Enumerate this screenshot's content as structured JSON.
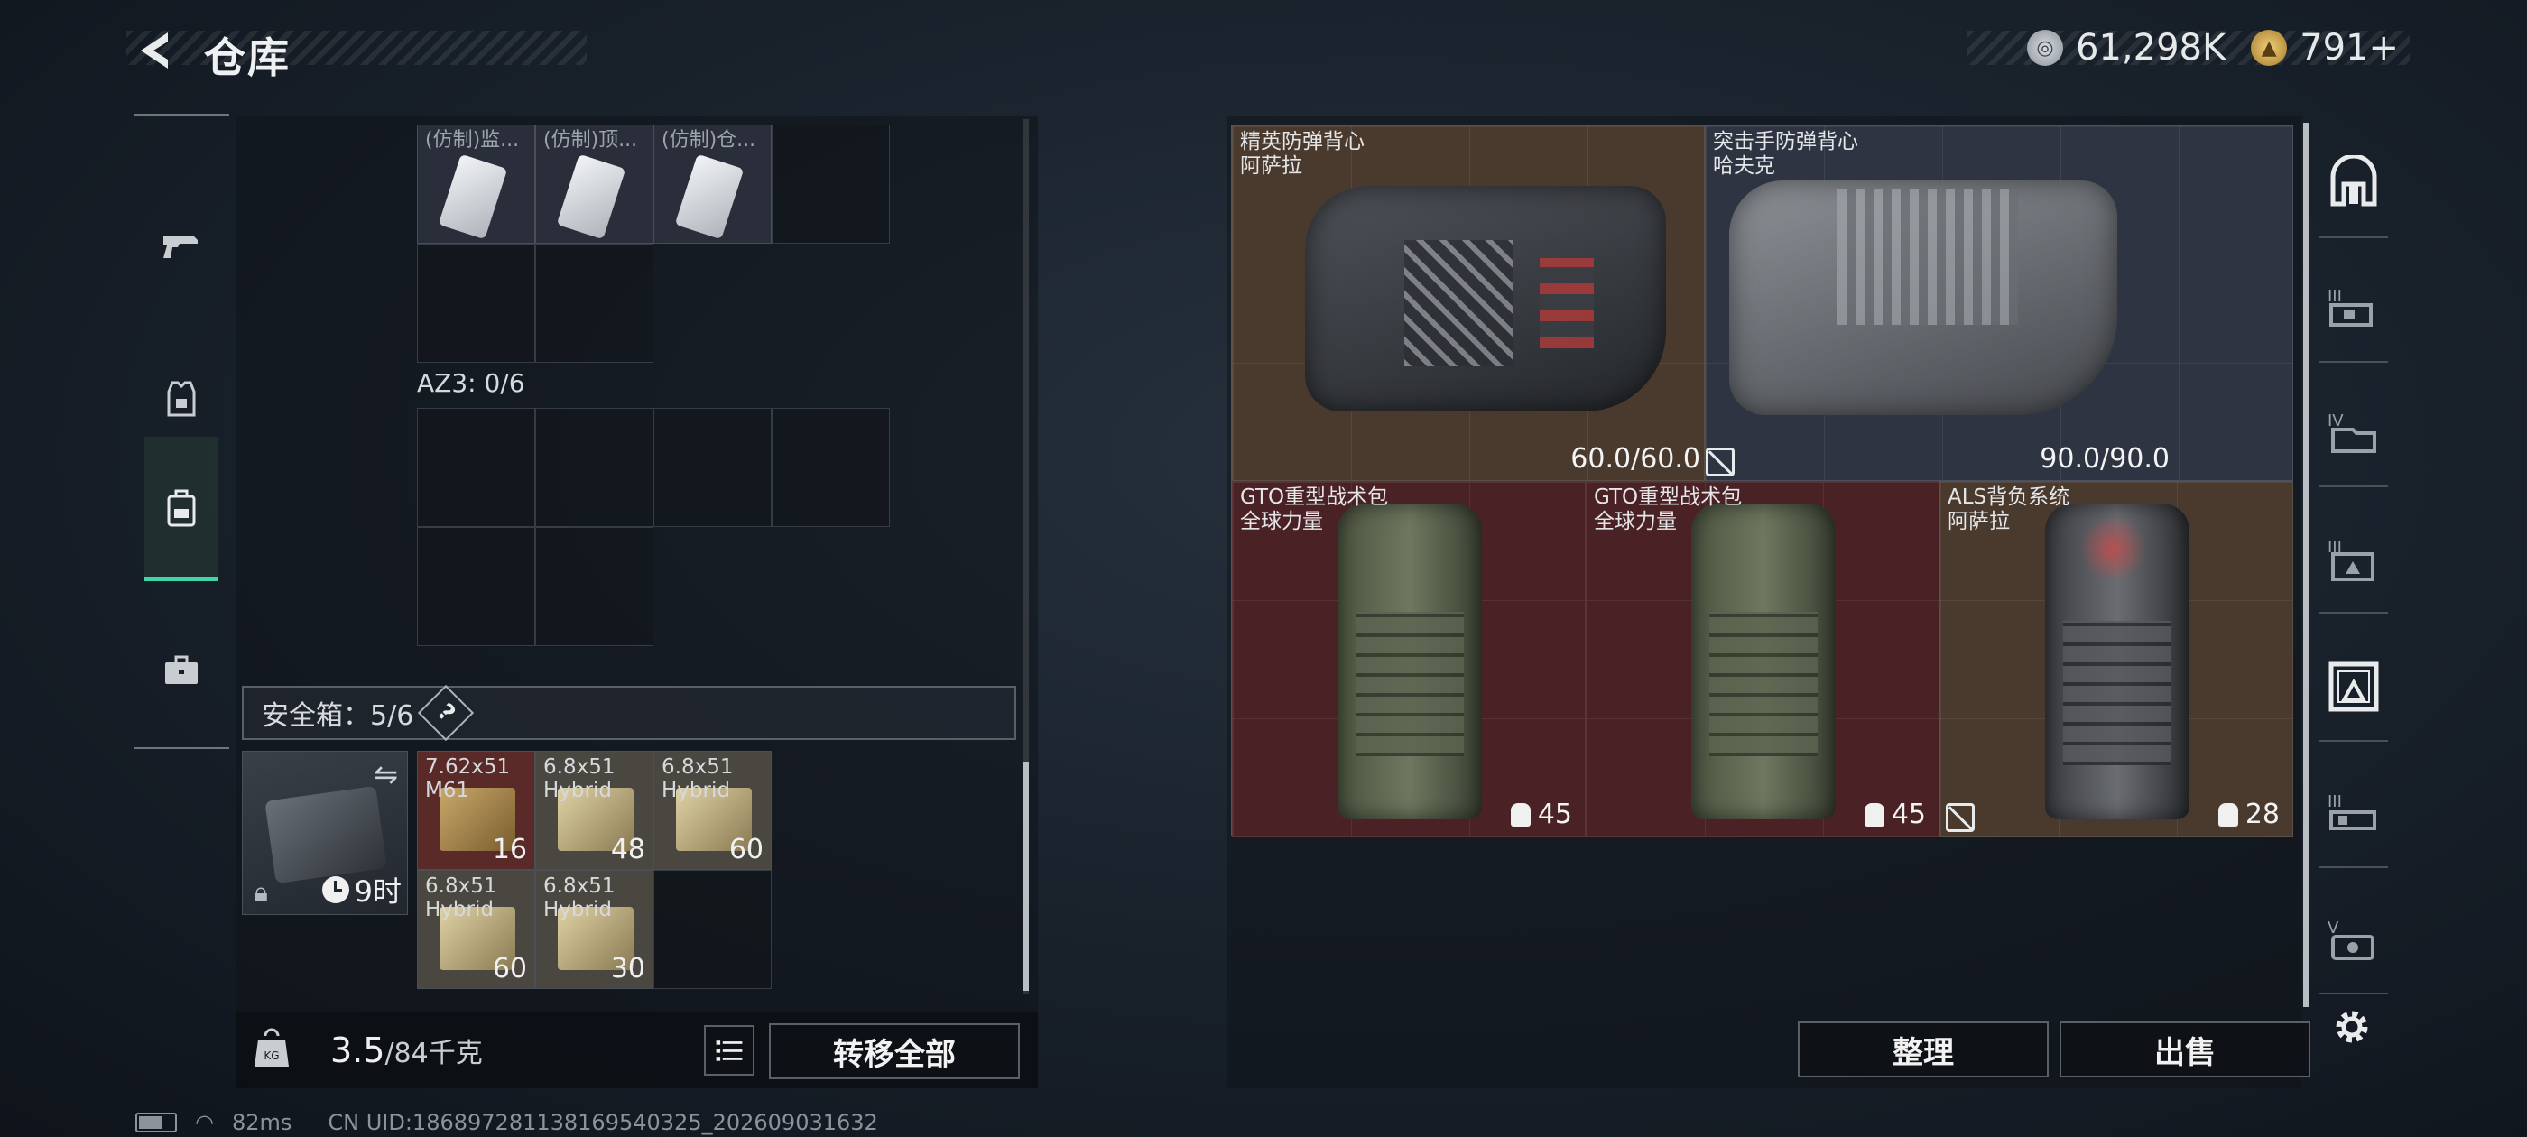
{
  "header": {
    "title": "仓库",
    "currency1": "61,298K",
    "currency2": "791+"
  },
  "left_tabs": [
    "weapon-tab",
    "armor-tab",
    "backpack-tab",
    "case-tab"
  ],
  "container_items": [
    {
      "name": "(仿制)监..."
    },
    {
      "name": "(仿制)顶..."
    },
    {
      "name": "(仿制)仓..."
    }
  ],
  "az3": {
    "label": "AZ3: 0/6"
  },
  "safebox": {
    "label": "安全箱：5/6",
    "help": "?",
    "timer": "9时",
    "items": [
      {
        "name": "7.62x51\nM61",
        "count": "16",
        "bg": "#5a2a28"
      },
      {
        "name": "6.8x51\nHybrid",
        "count": "48",
        "bg": "#4a4640"
      },
      {
        "name": "6.8x51\nHybrid",
        "count": "60",
        "bg": "#4a4640"
      },
      {
        "name": "6.8x51\nHybrid",
        "count": "60",
        "bg": "#4a4640"
      },
      {
        "name": "6.8x51\nHybrid",
        "count": "30",
        "bg": "#4a4640"
      }
    ]
  },
  "footer_left": {
    "weight_value": "3.5",
    "weight_max": "/84千克",
    "transfer_all": "转移全部"
  },
  "stash_items": [
    {
      "name": "精英防弹背心\n阿萨拉",
      "value": "60.0/60.0",
      "bg": "#4a3a2e"
    },
    {
      "name": "突击手防弹背心\n哈夫克",
      "value": "90.0/90.0",
      "bg": "#2e3442"
    },
    {
      "name": "GTO重型战术包\n全球力量",
      "value": "45",
      "bg": "#4a2226"
    },
    {
      "name": "GTO重型战术包\n全球力量",
      "value": "45",
      "bg": "#4a2226"
    },
    {
      "name": "ALS背负系统\n阿萨拉",
      "value": "28",
      "bg": "#4a3a2e"
    }
  ],
  "footer_right": {
    "sort": "整理",
    "sell": "出售"
  },
  "status": {
    "ping": "82ms",
    "uid": "CN UID:186897281138169540325_202609031632"
  },
  "colors": {
    "accent": "#3fd6a6",
    "gold_rarity": "#4a3a2e",
    "red_rarity": "#4a2226",
    "blue_rarity": "#2e3442"
  }
}
